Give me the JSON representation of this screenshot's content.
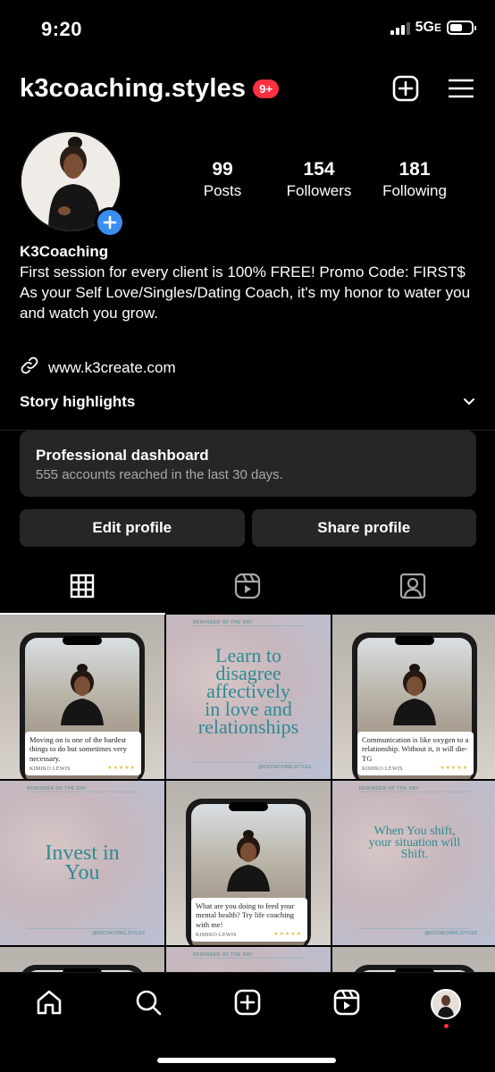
{
  "status_bar": {
    "time": "9:20",
    "network": "5G",
    "network_suffix": "E",
    "signal_bars": 3,
    "battery_level": 0.6
  },
  "header": {
    "username": "k3coaching.styles",
    "notification_badge": "9+",
    "create_icon": "plus-square-icon",
    "menu_icon": "hamburger-menu-icon"
  },
  "profile": {
    "stats": [
      {
        "value": "99",
        "label": "Posts"
      },
      {
        "value": "154",
        "label": "Followers"
      },
      {
        "value": "181",
        "label": "Following"
      }
    ],
    "name": "K3Coaching",
    "bio_line1": "First session for every client is 100% FREE! Promo Code: FIRST$",
    "bio_line2": "As your Self Love/Singles/Dating Coach, it's my honor to water you and watch you grow.",
    "link": "www.k3create.com"
  },
  "highlights": {
    "label": "Story highlights"
  },
  "dashboard": {
    "title": "Professional dashboard",
    "subtitle": "555 accounts reached in the last 30 days."
  },
  "buttons": {
    "edit": "Edit profile",
    "share": "Share profile"
  },
  "tabs": [
    {
      "icon": "grid-icon",
      "active": true
    },
    {
      "icon": "reels-icon",
      "active": false
    },
    {
      "icon": "tagged-icon",
      "active": false
    }
  ],
  "posts": [
    {
      "type": "phone",
      "caption": "Moving on is one of the hardest things to do but sometimes very necessary.",
      "signature": "KIMIKO LEWIS",
      "stars": "★★★★★"
    },
    {
      "type": "quote",
      "header": "REMINDER OF THE DAY",
      "text": "Learn to disagree affectively in love and relationships",
      "handle": "@K3COACHING.STYLES"
    },
    {
      "type": "phone",
      "caption": "Communication is like oxygen to a relationship. Without it, it will die- TG",
      "signature": "KIMIKO LEWIS",
      "stars": "★★★★★"
    },
    {
      "type": "quote",
      "header": "REMINDER OF THE DAY",
      "text": "Invest in You",
      "handle": "@K3COACHING.STYLES"
    },
    {
      "type": "phone",
      "caption": "What are you doing to feed your mental health? Try life coaching with me!",
      "signature": "KIMIKO LEWIS",
      "stars": "★★★★★"
    },
    {
      "type": "quote",
      "header": "REMINDER OF THE DAY",
      "text": "When You shift, your situation will Shift.",
      "handle": "@K3COACHING.STYLES"
    },
    {
      "type": "phone",
      "caption": "",
      "signature": "",
      "stars": ""
    },
    {
      "type": "quote",
      "header": "REMINDER OF THE DAY",
      "text": "",
      "handle": ""
    },
    {
      "type": "phone",
      "caption": "",
      "signature": "",
      "stars": ""
    }
  ],
  "bottom_nav": [
    {
      "icon": "home-icon"
    },
    {
      "icon": "search-icon"
    },
    {
      "icon": "create-post-icon"
    },
    {
      "icon": "reels-icon"
    },
    {
      "icon": "profile-avatar-icon"
    }
  ]
}
